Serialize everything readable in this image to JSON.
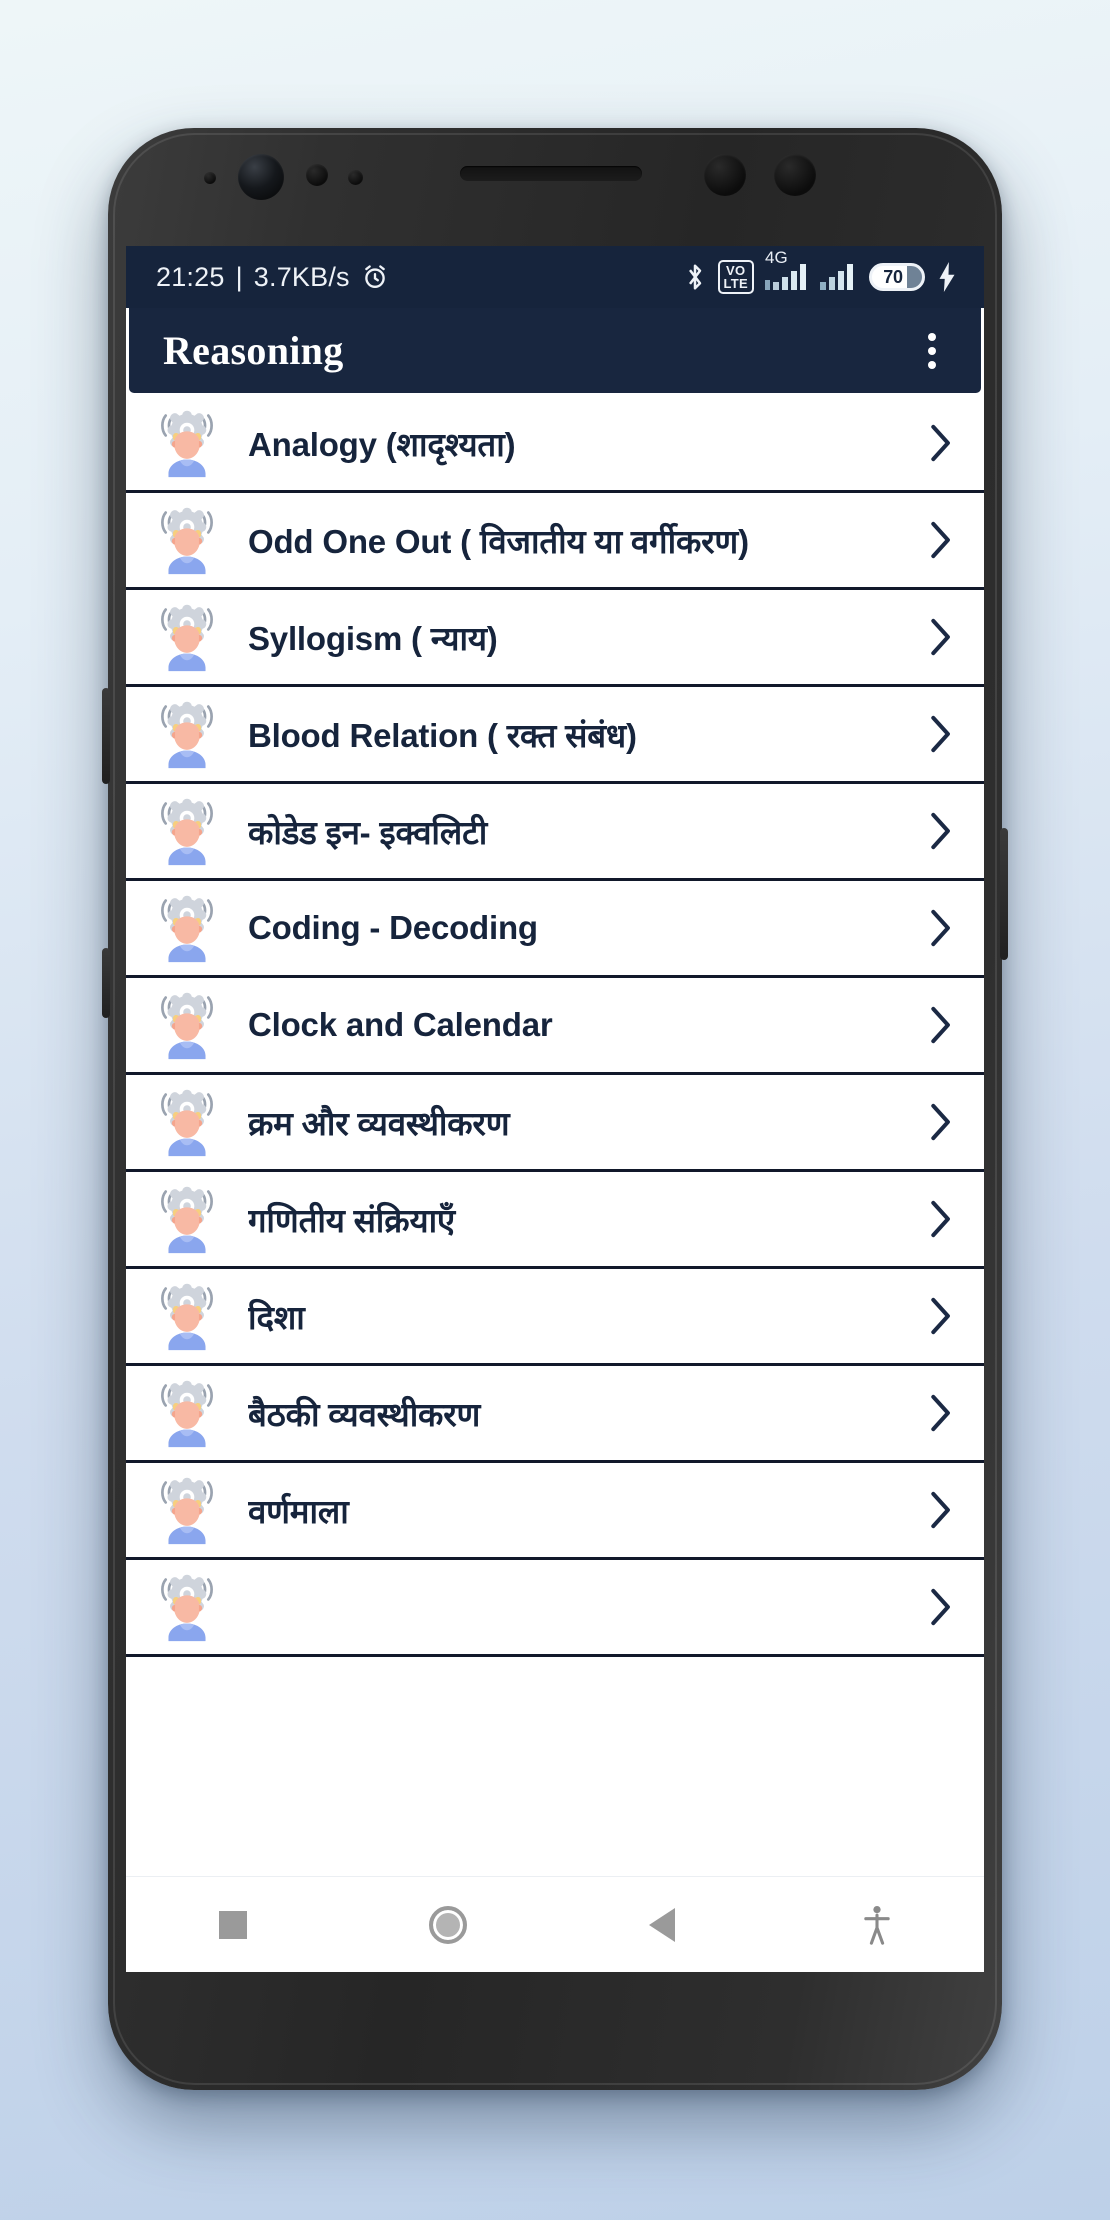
{
  "device": {
    "type": "android-smartphone",
    "frame_color": "#2d2d2d"
  },
  "status_bar": {
    "background": "#16243c",
    "time": "21:25",
    "separator": "|",
    "network_speed": "3.7KB/s",
    "alarm_icon": "alarm-clock-icon",
    "bluetooth_icon": "bluetooth-icon",
    "volte_line1": "VO",
    "volte_line2": "LTE",
    "network_type": "4G",
    "signal_icon_1": "signal-bars-icon",
    "signal_icon_2": "signal-bars-icon",
    "battery_level": "70",
    "charging_icon": "charging-bolt-icon"
  },
  "app_bar": {
    "title": "Reasoning",
    "background": "#18263f",
    "text_color": "#ffffff",
    "overflow_icon": "three-dot-overflow-icon"
  },
  "list": {
    "row_icon": "person-thinking-gear-icon",
    "chevron_icon": "chevron-right-icon",
    "items": [
      {
        "label": "Analogy (शादृश्यता)"
      },
      {
        "label": "Odd One Out ( विजातीय या वर्गीकरण)"
      },
      {
        "label": "Syllogism ( न्याय)"
      },
      {
        "label": "Blood Relation ( रक्त संबंध)"
      },
      {
        "label": "कोडेड इन- इक्वलिटी"
      },
      {
        "label": "Coding - Decoding"
      },
      {
        "label": "Clock and Calendar"
      },
      {
        "label": "क्रम और व्यवस्थीकरण"
      },
      {
        "label": "गणितीय संक्रियाएँ"
      },
      {
        "label": "दिशा"
      },
      {
        "label": "बैठकी व्यवस्थीकरण"
      },
      {
        "label": "वर्णमाला"
      },
      {
        "label": ""
      }
    ]
  },
  "nav_bar": {
    "recents_icon": "square-recents-icon",
    "home_icon": "circle-home-icon",
    "back_icon": "triangle-back-icon",
    "accessibility_icon": "accessibility-icon"
  }
}
